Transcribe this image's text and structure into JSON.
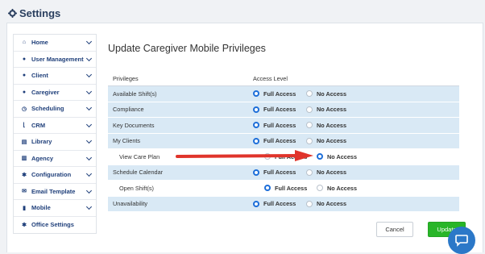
{
  "page": {
    "title": "Settings"
  },
  "sidebar": {
    "items": [
      {
        "label": "Home",
        "icon": "home-icon",
        "glyph": "⌂"
      },
      {
        "label": "User Management",
        "icon": "user-icon",
        "glyph": "●"
      },
      {
        "label": "Client",
        "icon": "user-icon",
        "glyph": "●"
      },
      {
        "label": "Caregiver",
        "icon": "user-icon",
        "glyph": "●"
      },
      {
        "label": "Scheduling",
        "icon": "clock-icon",
        "glyph": "◷"
      },
      {
        "label": "CRM",
        "icon": "chart-icon",
        "glyph": "⌊"
      },
      {
        "label": "Library",
        "icon": "book-icon",
        "glyph": "▤"
      },
      {
        "label": "Agency",
        "icon": "building-icon",
        "glyph": "▥"
      },
      {
        "label": "Configuration",
        "icon": "gears-icon",
        "glyph": "✱"
      },
      {
        "label": "Email Template",
        "icon": "envelope-icon",
        "glyph": "✉"
      },
      {
        "label": "Mobile",
        "icon": "mobile-icon",
        "glyph": "▮"
      },
      {
        "label": "Office Settings",
        "icon": "gear-icon",
        "glyph": "✱"
      }
    ]
  },
  "main": {
    "title": "Update Caregiver Mobile Privileges",
    "columns": {
      "privileges": "Privileges",
      "access": "Access Level"
    },
    "options": {
      "full": "Full Access",
      "none": "No Access"
    },
    "rows": [
      {
        "label": "Available Shift(s)",
        "selected": "full"
      },
      {
        "label": "Compliance",
        "selected": "full"
      },
      {
        "label": "Key Documents",
        "selected": "full"
      },
      {
        "label": "My Clients",
        "selected": "full"
      },
      {
        "label": "View Care Plan",
        "selected": "none"
      },
      {
        "label": "Schedule Calendar",
        "selected": "full"
      },
      {
        "label": "Open Shift(s)",
        "selected": "full"
      },
      {
        "label": "Unavailability",
        "selected": "full"
      }
    ]
  },
  "buttons": {
    "cancel": "Cancel",
    "update": "Update"
  },
  "colors": {
    "accent": "#1e6fd9",
    "row": "#d9e9f5",
    "update": "#28b528",
    "arrow": "#e0342b"
  }
}
